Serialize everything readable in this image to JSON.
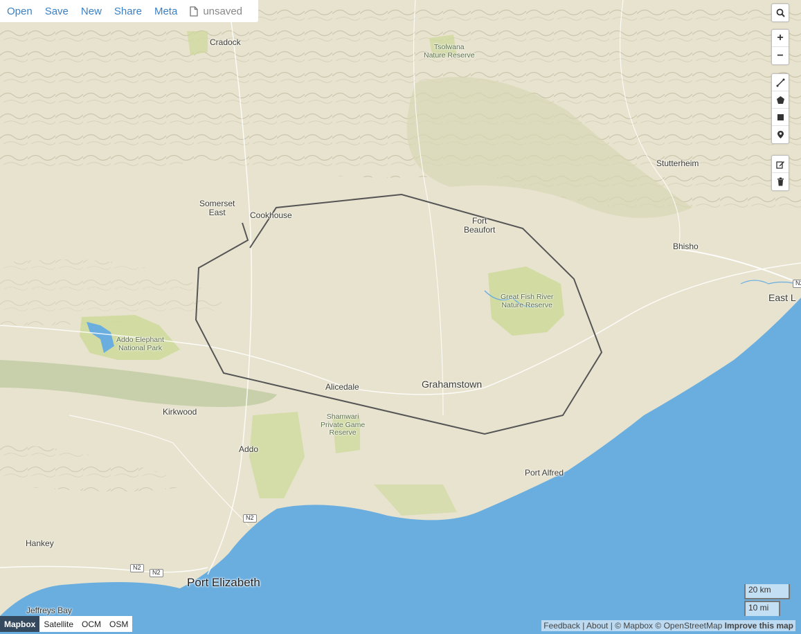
{
  "menu": {
    "items": [
      {
        "label": "Open"
      },
      {
        "label": "Save"
      },
      {
        "label": "New"
      },
      {
        "label": "Share"
      },
      {
        "label": "Meta"
      }
    ],
    "file_status": "unsaved",
    "file_icon": "file-icon"
  },
  "controls": {
    "search_icon": "search-icon",
    "zoom_in": "+",
    "zoom_out": "−",
    "draw_tools": [
      "line-icon",
      "polygon-icon",
      "rectangle-icon",
      "marker-icon"
    ],
    "edit_tools": [
      "edit-icon",
      "trash-icon"
    ]
  },
  "map": {
    "labels": {
      "cradock": "Cradock",
      "tsolwana": "Tsolwana\nNature Reserve",
      "stutterheim": "Stutterheim",
      "somerset_east": "Somerset\nEast",
      "cookhouse": "Cookhouse",
      "fort_beaufort": "Fort\nBeaufort",
      "bhisho": "Bhisho",
      "east_london": "East L",
      "great_fish": "Great Fish River\nNature Reserve",
      "addo_park": "Addo Elephant\nNational Park",
      "alicedale": "Alicedale",
      "grahamstown": "Grahamstown",
      "kirkwood": "Kirkwood",
      "shamwari": "Shamwari\nPrivate Game\nReserve",
      "addo": "Addo",
      "port_alfred": "Port Alfred",
      "hankey": "Hankey",
      "port_elizabeth": "Port Elizabeth",
      "jeffreys_bay": "Jeffreys Bay",
      "n2_a": "N2",
      "n2_b": "N2",
      "n2_c": "N2",
      "n2_d": "N2"
    },
    "colors": {
      "land": "#e8e3cf",
      "ocean": "#6aaee0",
      "park": "#c8d98e",
      "polygon_stroke": "#555555"
    }
  },
  "layers": {
    "items": [
      {
        "label": "Mapbox",
        "active": true
      },
      {
        "label": "Satellite",
        "active": false
      },
      {
        "label": "OCM",
        "active": false
      },
      {
        "label": "OSM",
        "active": false
      }
    ]
  },
  "attribution": {
    "feedback": "Feedback",
    "about": "About",
    "mapbox": "© Mapbox",
    "osm": "© OpenStreetMap",
    "improve": "Improve this map"
  },
  "scale": {
    "metric": "20 km",
    "imperial": "10 mi"
  }
}
